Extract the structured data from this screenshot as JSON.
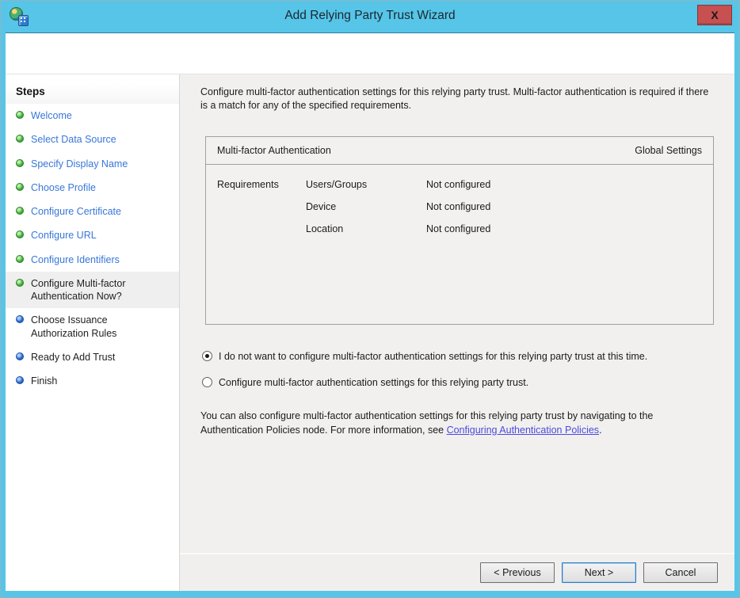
{
  "window": {
    "title": "Add Relying Party Trust Wizard",
    "close_label": "x"
  },
  "sidebar": {
    "heading": "Steps",
    "items": [
      {
        "label": "Welcome",
        "state": "done"
      },
      {
        "label": "Select Data Source",
        "state": "done"
      },
      {
        "label": "Specify Display Name",
        "state": "done"
      },
      {
        "label": "Choose Profile",
        "state": "done"
      },
      {
        "label": "Configure Certificate",
        "state": "done"
      },
      {
        "label": "Configure URL",
        "state": "done"
      },
      {
        "label": "Configure Identifiers",
        "state": "done"
      },
      {
        "label": "Configure Multi-factor Authentication Now?",
        "state": "current"
      },
      {
        "label": "Choose Issuance Authorization Rules",
        "state": "upcoming"
      },
      {
        "label": "Ready to Add Trust",
        "state": "upcoming"
      },
      {
        "label": "Finish",
        "state": "upcoming"
      }
    ]
  },
  "content": {
    "intro": "Configure multi-factor authentication settings for this relying party trust. Multi-factor authentication is required if there is a match for any of the specified requirements.",
    "table": {
      "header_left": "Multi-factor Authentication",
      "header_right": "Global Settings",
      "group_label": "Requirements",
      "rows": [
        {
          "name": "Users/Groups",
          "value": "Not configured"
        },
        {
          "name": "Device",
          "value": "Not configured"
        },
        {
          "name": "Location",
          "value": "Not configured"
        }
      ]
    },
    "radios": [
      {
        "label": "I do not want to configure multi-factor authentication settings for this relying party trust at this time.",
        "selected": true
      },
      {
        "label": "Configure multi-factor authentication settings for this relying party trust.",
        "selected": false
      }
    ],
    "note": {
      "before_link": "You can also configure multi-factor authentication settings for this relying party trust by navigating to the Authentication Policies node. For more information, see ",
      "link": "Configuring Authentication Policies",
      "after_link": "."
    }
  },
  "buttons": {
    "previous": "< Previous",
    "next": "Next >",
    "cancel": "Cancel"
  },
  "colors": {
    "titlebar": "#56c5e8",
    "close_button": "#c75050",
    "sidebar_link": "#3777d9",
    "hyperlink": "#4b4bdb",
    "done_dot": "#47b53f",
    "upcoming_dot": "#2f6fd4",
    "content_bg": "#f1f0ef",
    "next_focus_border": "#2e7ac6"
  }
}
